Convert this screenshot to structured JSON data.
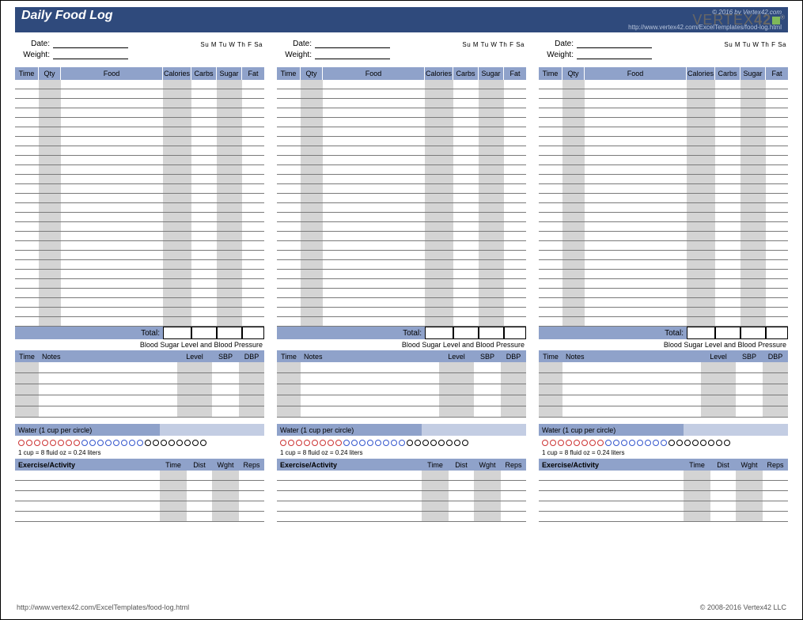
{
  "header": {
    "title": "Daily Food Log",
    "copyright": "© 2016 by Vertex42.com",
    "source_url": "http://www.vertex42.com/ExcelTemplates/food-log.html",
    "logo_text": "VERTEX",
    "logo_num": "42"
  },
  "meta": {
    "date_label": "Date:",
    "weight_label": "Weight:",
    "days": "Su  M  Tu  W  Th  F  Sa"
  },
  "food": {
    "h_time": "Time",
    "h_qty": "Qty",
    "h_food": "Food",
    "h_cal": "Calories",
    "h_carb": "Carbs",
    "h_sug": "Sugar",
    "h_fat": "Fat",
    "total_label": "Total:"
  },
  "bp": {
    "caption": "Blood Sugar Level and Blood Pressure",
    "h_time": "Time",
    "h_notes": "Notes",
    "h_level": "Level",
    "h_sbp": "SBP",
    "h_dbp": "DBP"
  },
  "water": {
    "header": "Water (1 cup per circle)",
    "note": "1 cup = 8 fluid oz = 0.24 liters",
    "circles": [
      "red",
      "red",
      "red",
      "red",
      "red",
      "red",
      "red",
      "red",
      "blue",
      "blue",
      "blue",
      "blue",
      "blue",
      "blue",
      "blue",
      "blue",
      "black",
      "black",
      "black",
      "black",
      "black",
      "black",
      "black",
      "black"
    ]
  },
  "exercise": {
    "h_act": "Exercise/Activity",
    "h_time": "Time",
    "h_dist": "Dist",
    "h_wght": "Wght",
    "h_reps": "Reps"
  },
  "footer": {
    "url": "http://www.vertex42.com/ExcelTemplates/food-log.html",
    "copyright": "© 2008-2016 Vertex42 LLC"
  }
}
